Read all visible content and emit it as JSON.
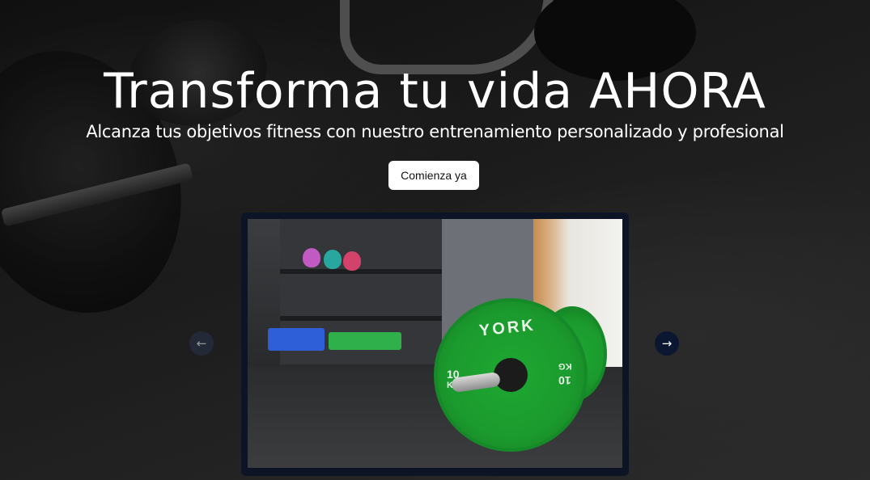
{
  "hero": {
    "title": "Transforma tu vida AHORA",
    "subtitle": "Alcanza tus objetivos fitness con nuestro entrenamiento personalizado y profesional",
    "cta_label": "Comienza ya"
  },
  "carousel": {
    "slide": {
      "plate_brand": "YORK",
      "plate_weight_left": "10",
      "plate_weight_unit": "KG",
      "plate_weight_right": "10",
      "plate_weight_right_unit": "KG"
    },
    "prev_icon": "arrow-left-icon",
    "next_icon": "arrow-right-icon",
    "prev_glyph": "←",
    "next_glyph": "→"
  },
  "colors": {
    "carousel_frame": "#0c1426",
    "next_button": "#0b1630",
    "cta_background": "#ffffff",
    "plate_green": "#1ea832"
  }
}
